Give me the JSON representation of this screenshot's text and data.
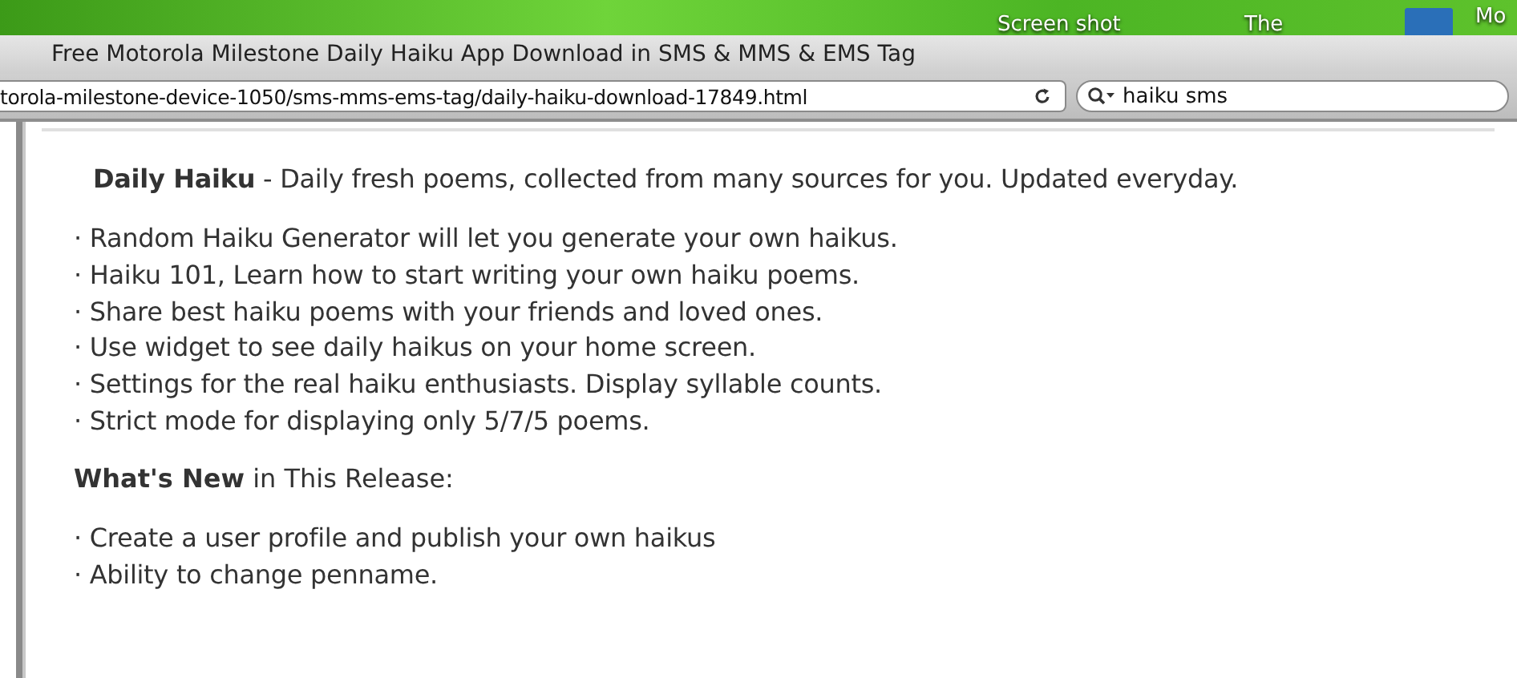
{
  "desktop": {
    "icon_labels": [
      "Screen shot",
      "The",
      "Mo"
    ]
  },
  "window": {
    "title": "Free Motorola Milestone Daily Haiku App Download in SMS & MMS & EMS Tag"
  },
  "toolbar": {
    "address": "torola-milestone-device-1050/sms-mms-ems-tag/daily-haiku-download-17849.html",
    "search": {
      "value": "haiku sms"
    }
  },
  "content": {
    "intro": "**Daily Haiku** - Daily fresh poems, collected from many sources for you. Updated everyday.",
    "features": [
      "· Random Haiku Generator will let you generate your own haikus.",
      "· Haiku 101, Learn how to start writing your own haiku poems.",
      "· Share best haiku poems with your friends and loved ones.",
      "· Use widget to see daily haikus on your home screen.",
      "· Settings for the real haiku enthusiasts. Display syllable counts.",
      "· Strict mode for displaying only 5/7/5 poems."
    ],
    "whats_new_heading": "**What's New** in This Release:",
    "whats_new": [
      "· Create a user profile and publish your own haikus",
      "· Ability to change penname."
    ]
  }
}
